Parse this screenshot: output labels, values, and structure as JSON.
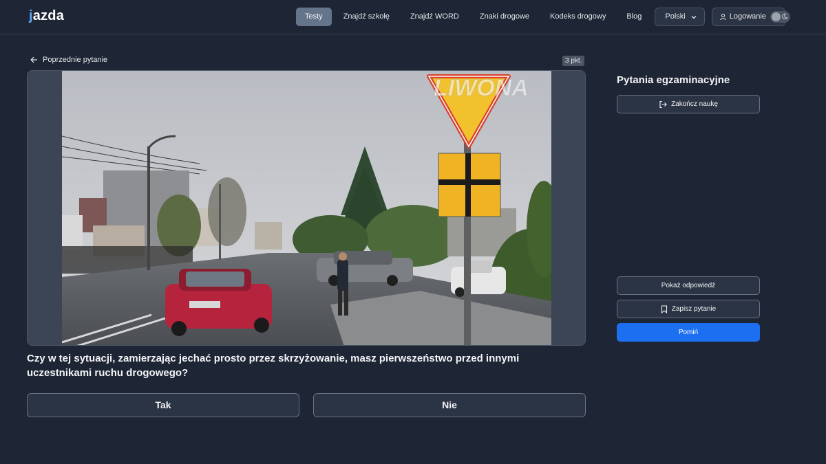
{
  "brand": {
    "logo_text": "jazda",
    "accent": "#60a5fa"
  },
  "nav": {
    "items": [
      {
        "label": "Testy",
        "active": true
      },
      {
        "label": "Znajdź szkołę"
      },
      {
        "label": "Znajdź WORD"
      },
      {
        "label": "Znaki drogowe"
      },
      {
        "label": "Kodeks drogowy"
      },
      {
        "label": "Blog"
      }
    ],
    "language": "Polski",
    "login": "Logowanie"
  },
  "question": {
    "back_label": "Poprzednie pytanie",
    "points": "3 pkt.",
    "image_watermark": "LIWONA",
    "text": "Czy w tej sytuacji, zamierzając jechać prosto przez skrzyżowanie, masz pierwszeństwo przed innymi uczestnikami ruchu drogowego?",
    "answers": [
      "Tak",
      "Nie"
    ]
  },
  "sidebar": {
    "title": "Pytania egzaminacyjne",
    "end_label": "Zakończ naukę",
    "show_answer_label": "Pokaż odpowiedź",
    "save_label": "Zapisz pytanie",
    "skip_label": "Pomiń",
    "primary_color": "#1d6ff2"
  },
  "icons": [
    "chevron-down-icon",
    "user-icon",
    "moon-icon",
    "arrow-left-icon",
    "logout-icon",
    "bookmark-icon"
  ]
}
